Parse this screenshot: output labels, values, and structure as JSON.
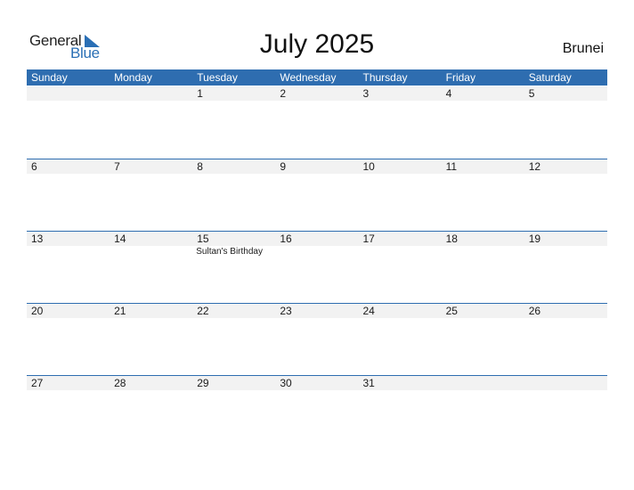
{
  "logo": {
    "part1": "General",
    "part2": "Blue"
  },
  "title": "July 2025",
  "country": "Brunei",
  "colors": {
    "accent": "#2e6db0",
    "daybar": "#f2f2f2"
  },
  "weekdays": [
    "Sunday",
    "Monday",
    "Tuesday",
    "Wednesday",
    "Thursday",
    "Friday",
    "Saturday"
  ],
  "weeks": [
    [
      {
        "day": ""
      },
      {
        "day": ""
      },
      {
        "day": "1"
      },
      {
        "day": "2"
      },
      {
        "day": "3"
      },
      {
        "day": "4"
      },
      {
        "day": "5"
      }
    ],
    [
      {
        "day": "6"
      },
      {
        "day": "7"
      },
      {
        "day": "8"
      },
      {
        "day": "9"
      },
      {
        "day": "10"
      },
      {
        "day": "11"
      },
      {
        "day": "12"
      }
    ],
    [
      {
        "day": "13"
      },
      {
        "day": "14"
      },
      {
        "day": "15",
        "event": "Sultan's Birthday"
      },
      {
        "day": "16"
      },
      {
        "day": "17"
      },
      {
        "day": "18"
      },
      {
        "day": "19"
      }
    ],
    [
      {
        "day": "20"
      },
      {
        "day": "21"
      },
      {
        "day": "22"
      },
      {
        "day": "23"
      },
      {
        "day": "24"
      },
      {
        "day": "25"
      },
      {
        "day": "26"
      }
    ],
    [
      {
        "day": "27"
      },
      {
        "day": "28"
      },
      {
        "day": "29"
      },
      {
        "day": "30"
      },
      {
        "day": "31"
      },
      {
        "day": ""
      },
      {
        "day": ""
      }
    ]
  ]
}
